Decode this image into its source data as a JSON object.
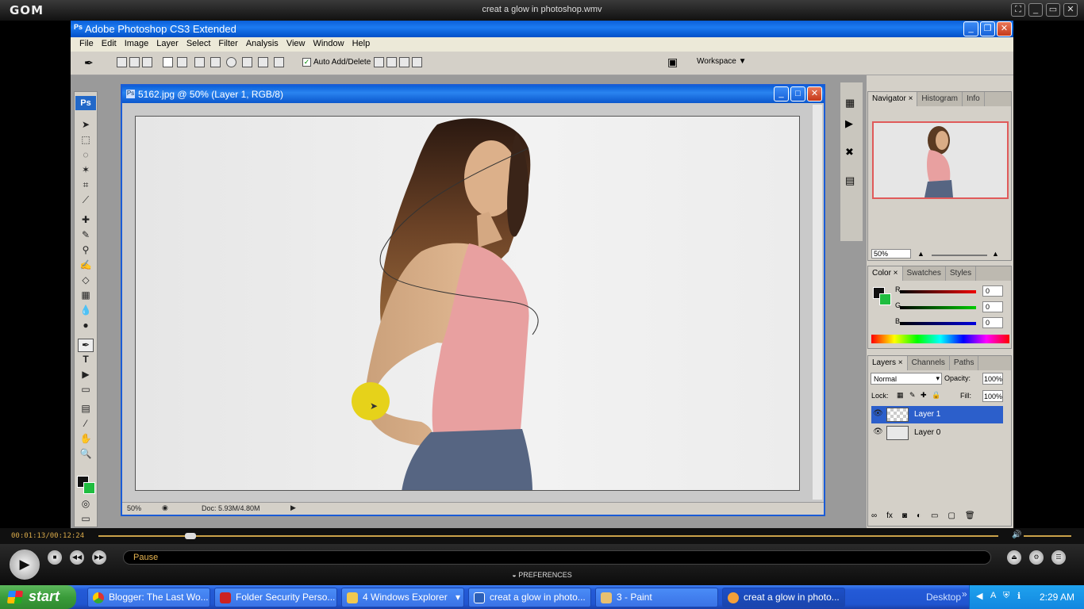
{
  "player": {
    "logo": "GOM",
    "filename": "creat a glow in photoshop.wmv",
    "time": "00:01:13/00:12:24",
    "status": "Pause",
    "preferences": "PREFERENCES",
    "seek_progress": 0.09
  },
  "photoshop": {
    "title": "Adobe Photoshop CS3 Extended",
    "app_icon": "Ps",
    "menu": [
      "File",
      "Edit",
      "Image",
      "Layer",
      "Select",
      "Filter",
      "Analysis",
      "View",
      "Window",
      "Help"
    ],
    "options": {
      "auto_add_delete": "Auto Add/Delete",
      "auto_add_delete_checked": true,
      "workspace": "Workspace ▼"
    },
    "toolbox_logo": "Ps",
    "document": {
      "title": "5162.jpg @ 50% (Layer 1, RGB/8)",
      "zoom": "50%",
      "doc_size": "Doc: 5.93M/4.80M"
    },
    "navigator": {
      "tabs": [
        "Navigator ×",
        "Histogram",
        "Info"
      ],
      "zoom": "50%"
    },
    "color": {
      "tabs": [
        "Color ×",
        "Swatches",
        "Styles"
      ],
      "r_label": "R",
      "g_label": "G",
      "b_label": "B",
      "r": "0",
      "g": "0",
      "b": "0",
      "foreground": "#111111",
      "background": "#1fbd3f"
    },
    "layers": {
      "tabs": [
        "Layers ×",
        "Channels",
        "Paths"
      ],
      "blend_mode": "Normal",
      "opacity_label": "Opacity:",
      "opacity": "100%",
      "lock_label": "Lock:",
      "fill_label": "Fill:",
      "fill": "100%",
      "items": [
        {
          "name": "Layer 1",
          "selected": true
        },
        {
          "name": "Layer 0",
          "selected": false
        }
      ]
    }
  },
  "taskbar": {
    "start": "start",
    "tasks": [
      {
        "label": "Blogger: The Last Wo...",
        "icon": "chrome-icon"
      },
      {
        "label": "Folder Security Perso...",
        "icon": "folder-security-icon"
      },
      {
        "label": "4 Windows Explorer",
        "icon": "folder-icon"
      },
      {
        "label": "creat a glow in photo...",
        "icon": "word-icon"
      },
      {
        "label": "3 - Paint",
        "icon": "paint-icon"
      },
      {
        "label": "creat a glow in photo...",
        "icon": "gom-icon"
      }
    ],
    "desktop": "Desktop",
    "clock": "2:29 AM"
  },
  "colors": {
    "xp_blue": "#245ad7",
    "gom_accent": "#e7b450",
    "cursor_highlight": "#e6d21a"
  }
}
